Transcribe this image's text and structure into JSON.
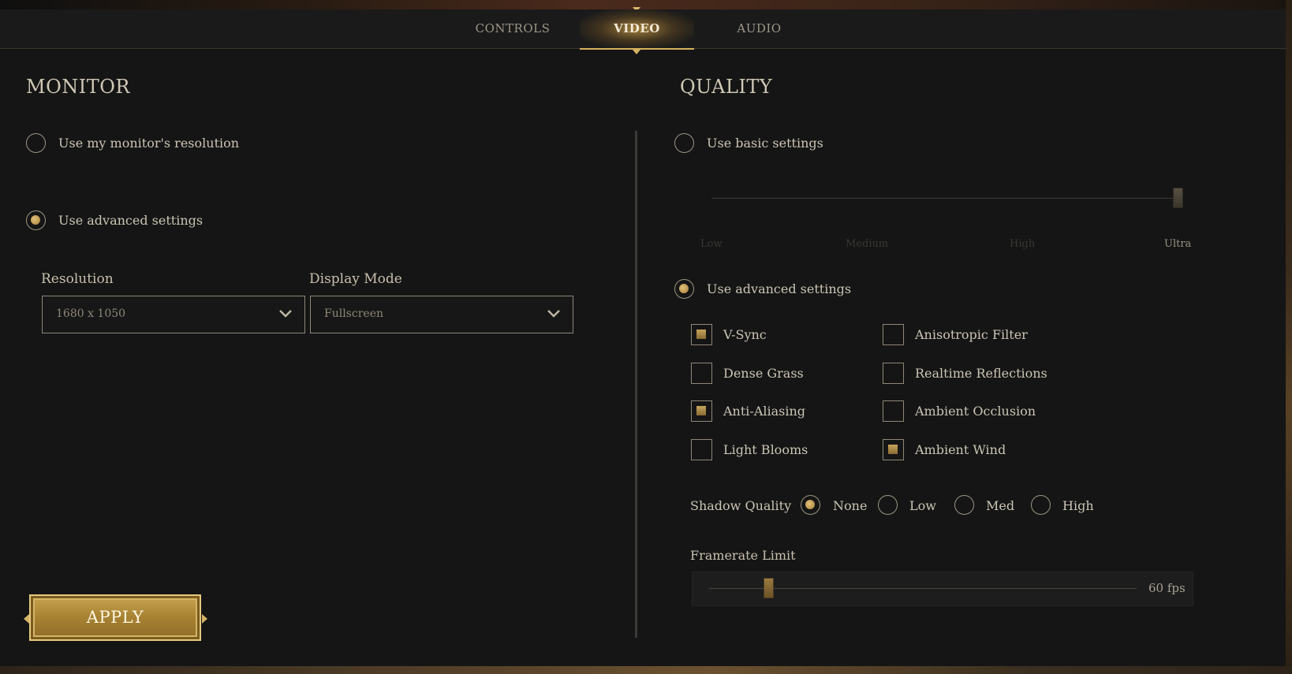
{
  "tabs": [
    {
      "label": "CONTROLS"
    },
    {
      "label": "VIDEO"
    },
    {
      "label": "AUDIO"
    }
  ],
  "monitor": {
    "title": "MONITOR",
    "option_monitor_res": "Use my monitor's resolution",
    "option_advanced": "Use advanced settings",
    "resolution_label": "Resolution",
    "resolution_value": "1680 x 1050",
    "display_mode_label": "Display Mode",
    "display_mode_value": "Fullscreen"
  },
  "quality": {
    "title": "QUALITY",
    "option_basic": "Use basic settings",
    "basic_levels": [
      "Low",
      "Medium",
      "High",
      "Ultra"
    ],
    "basic_selected": "Ultra",
    "option_advanced": "Use advanced settings",
    "checkboxes": [
      {
        "label": "V-Sync",
        "checked": true
      },
      {
        "label": "Anisotropic Filter",
        "checked": false
      },
      {
        "label": "Dense Grass",
        "checked": false
      },
      {
        "label": "Realtime Reflections",
        "checked": false
      },
      {
        "label": "Anti-Aliasing",
        "checked": true
      },
      {
        "label": "Ambient Occlusion",
        "checked": false
      },
      {
        "label": "Light Blooms",
        "checked": false
      },
      {
        "label": "Ambient Wind",
        "checked": true
      }
    ],
    "shadow_label": "Shadow Quality",
    "shadow_options": [
      "None",
      "Low",
      "Med",
      "High"
    ],
    "shadow_selected": "None",
    "framerate_label": "Framerate Limit",
    "framerate_value": "60 fps"
  },
  "apply_label": "APPLY",
  "colors": {
    "accent": "#c9a452",
    "background": "#181818",
    "text": "#cbc5b5"
  }
}
